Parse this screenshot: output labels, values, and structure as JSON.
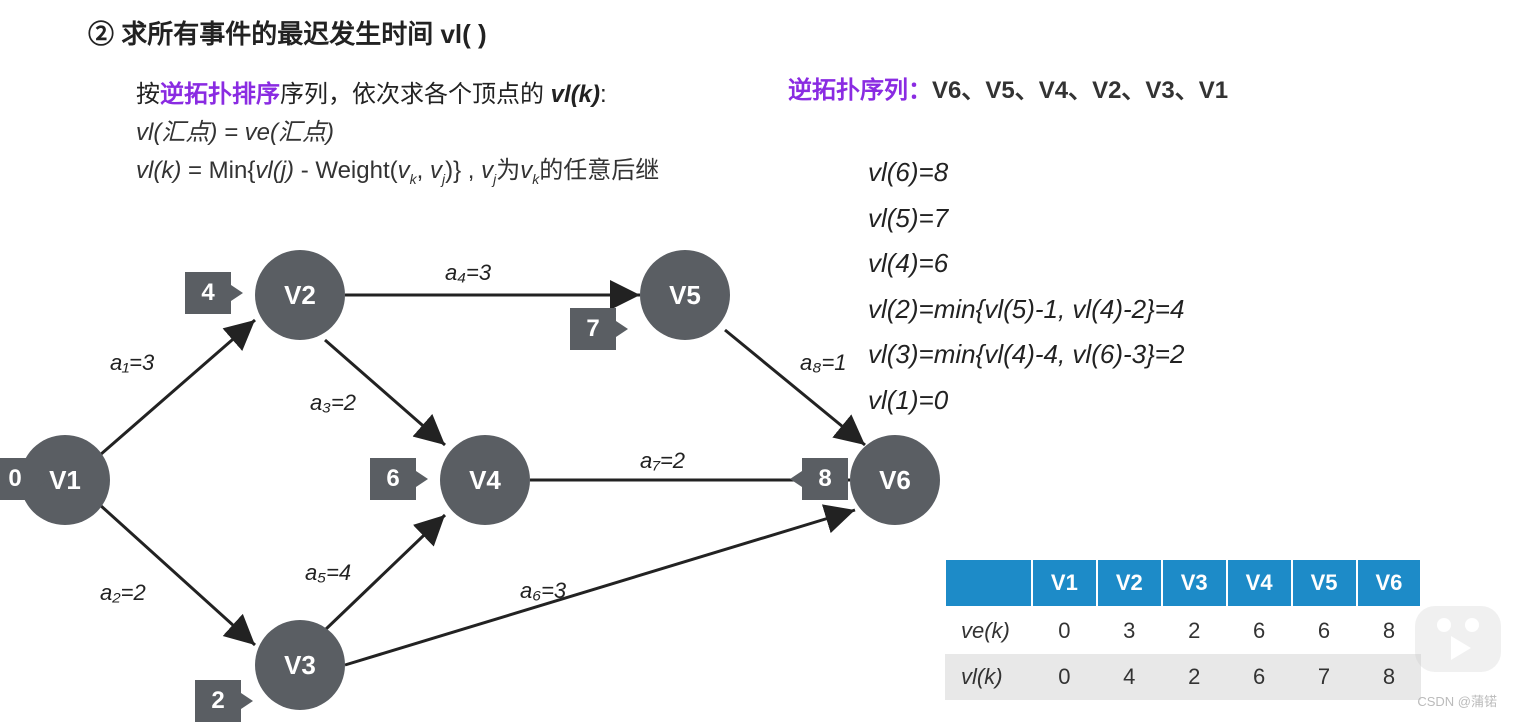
{
  "title": "② 求所有事件的最迟发生时间 vl( )",
  "sub1_prefix": "按",
  "sub1_keyword": "逆拓扑排序",
  "sub1_middle": "序列，依次求各个顶点的 ",
  "sub1_vlk": "vl(k)",
  "sub1_colon": ":",
  "sub2": "vl(汇点) = ve(汇点)",
  "sub3_a": "vl(k)",
  "sub3_b": " = Min{",
  "sub3_c": "vl(j)",
  "sub3_d": " - Weight(",
  "sub3_e": "v",
  "sub3_e_sub": "k",
  "sub3_f": ", ",
  "sub3_g": "v",
  "sub3_g_sub": "j",
  "sub3_h": ")} , ",
  "sub3_i": "v",
  "sub3_i_sub": "j",
  "sub3_j": "为",
  "sub3_k": "v",
  "sub3_k_sub": "k",
  "sub3_l": "的任意后继",
  "rev_label": "逆拓扑序列：",
  "rev_value": "V6、V5、V4、V2、V3、V1",
  "eqs": {
    "e1": "vl(6)=8",
    "e2": "vl(5)=7",
    "e3": "vl(4)=6",
    "e4": "vl(2)=min{vl(5)-1, vl(4)-2}=4",
    "e5": "vl(3)=min{vl(4)-4, vl(6)-3}=2",
    "e6": "vl(1)=0"
  },
  "nodes": {
    "v1": "V1",
    "v2": "V2",
    "v3": "V3",
    "v4": "V4",
    "v5": "V5",
    "v6": "V6"
  },
  "tags": {
    "t1": "0",
    "t2": "4",
    "t3": "2",
    "t4": "6",
    "t5": "7",
    "t6": "8"
  },
  "edges": {
    "a1": "a₁=3",
    "a2": "a₂=2",
    "a3": "a₃=2",
    "a4": "a₄=3",
    "a5": "a₅=4",
    "a6": "a₆=3",
    "a7": "a₇=2",
    "a8": "a₈=1"
  },
  "table": {
    "headers": [
      "",
      "V1",
      "V2",
      "V3",
      "V4",
      "V5",
      "V6"
    ],
    "rows": [
      {
        "label": "ve(k)",
        "vals": [
          "0",
          "3",
          "2",
          "6",
          "6",
          "8"
        ]
      },
      {
        "label": "vl(k)",
        "vals": [
          "0",
          "4",
          "2",
          "6",
          "7",
          "8"
        ]
      }
    ]
  },
  "watermark": "CSDN @蒲锘",
  "chart_data": {
    "type": "table",
    "title": "事件最早/最迟发生时间",
    "categories": [
      "V1",
      "V2",
      "V3",
      "V4",
      "V5",
      "V6"
    ],
    "series": [
      {
        "name": "ve(k)",
        "values": [
          0,
          3,
          2,
          6,
          6,
          8
        ]
      },
      {
        "name": "vl(k)",
        "values": [
          0,
          4,
          2,
          6,
          7,
          8
        ]
      }
    ]
  },
  "graph_data": {
    "nodes": [
      "V1",
      "V2",
      "V3",
      "V4",
      "V5",
      "V6"
    ],
    "edges": [
      {
        "from": "V1",
        "to": "V2",
        "name": "a1",
        "weight": 3
      },
      {
        "from": "V1",
        "to": "V3",
        "name": "a2",
        "weight": 2
      },
      {
        "from": "V2",
        "to": "V4",
        "name": "a3",
        "weight": 2
      },
      {
        "from": "V2",
        "to": "V5",
        "name": "a4",
        "weight": 3
      },
      {
        "from": "V3",
        "to": "V4",
        "name": "a5",
        "weight": 4
      },
      {
        "from": "V3",
        "to": "V6",
        "name": "a6",
        "weight": 3
      },
      {
        "from": "V4",
        "to": "V6",
        "name": "a7",
        "weight": 2
      },
      {
        "from": "V5",
        "to": "V6",
        "name": "a8",
        "weight": 1
      }
    ]
  }
}
